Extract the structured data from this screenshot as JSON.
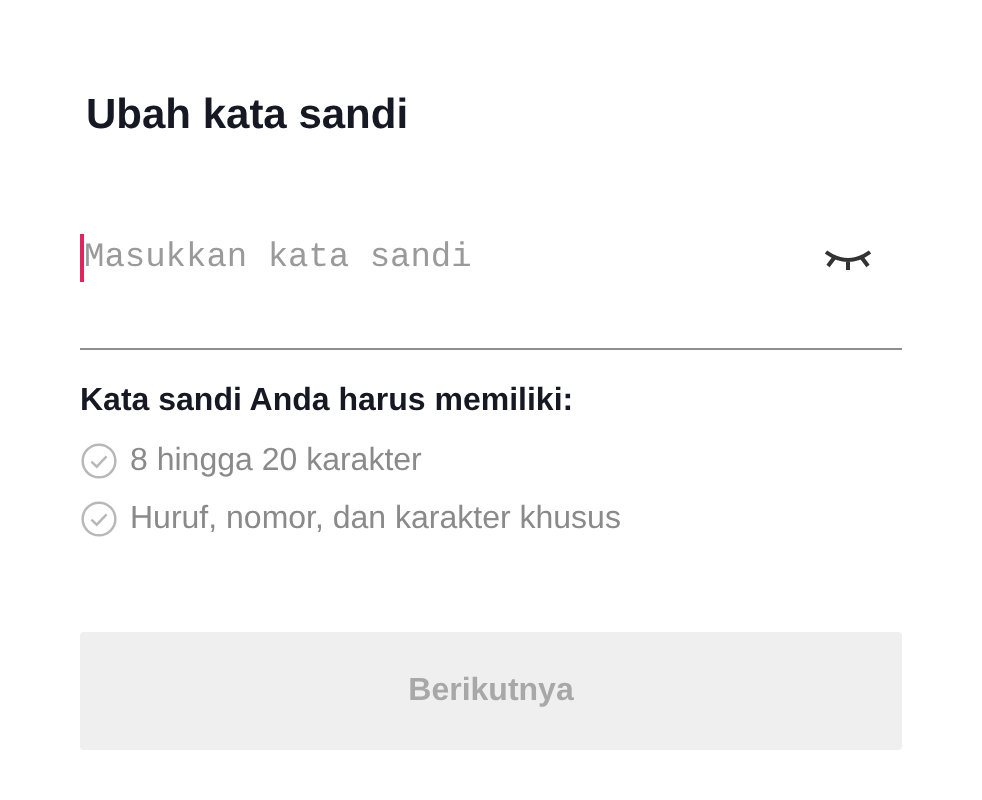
{
  "title": "Ubah kata sandi",
  "password_field": {
    "placeholder": "Masukkan kata sandi",
    "focused": true,
    "visible": false
  },
  "requirements_heading": "Kata sandi Anda harus memiliki:",
  "requirements": [
    {
      "label": "8 hingga 20 karakter",
      "met": false
    },
    {
      "label": "Huruf, nomor, dan karakter khusus",
      "met": false
    }
  ],
  "next_button": {
    "label": "Berikutnya",
    "disabled": true
  }
}
